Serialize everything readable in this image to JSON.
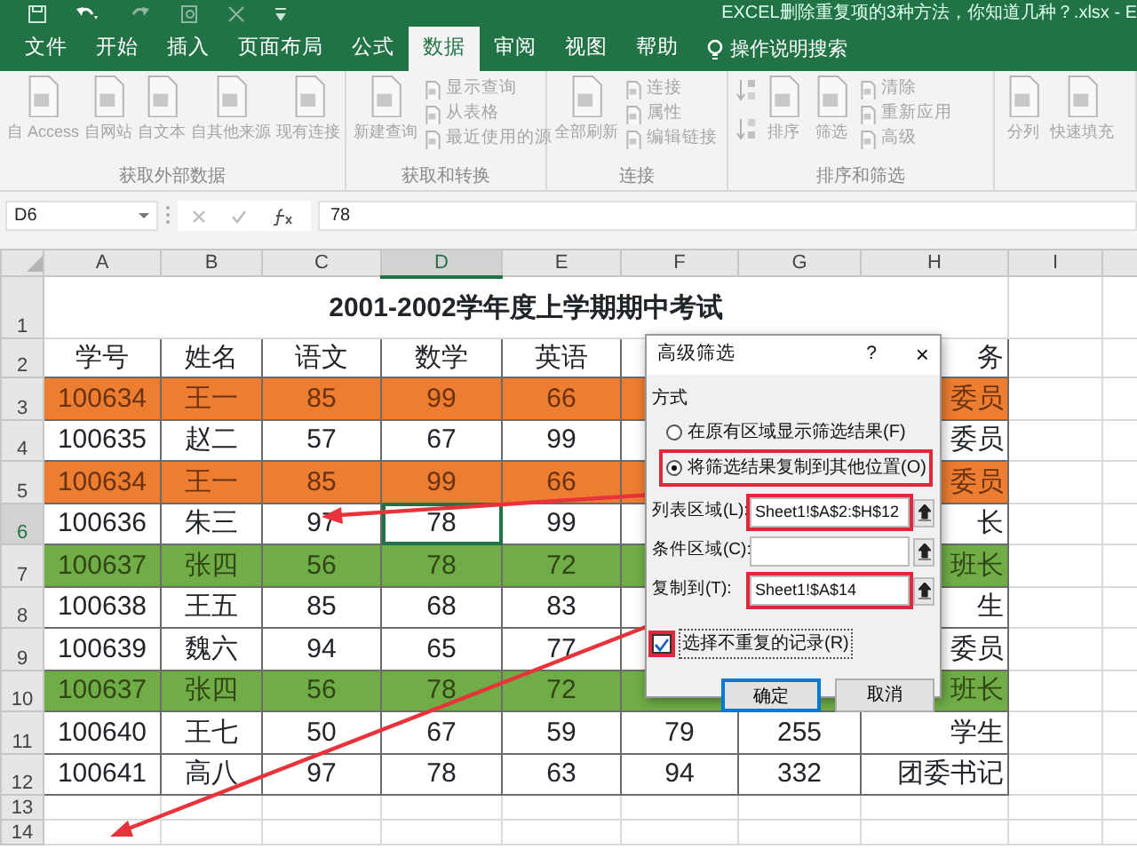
{
  "window": {
    "title": "EXCEL删除重复项的3种方法，你知道几种？.xlsx - E"
  },
  "tabs": [
    {
      "label": "文件",
      "selected": false
    },
    {
      "label": "开始",
      "selected": false
    },
    {
      "label": "插入",
      "selected": false
    },
    {
      "label": "页面布局",
      "selected": false
    },
    {
      "label": "公式",
      "selected": false
    },
    {
      "label": "数据",
      "selected": true
    },
    {
      "label": "审阅",
      "selected": false
    },
    {
      "label": "视图",
      "selected": false
    },
    {
      "label": "帮助",
      "selected": false
    }
  ],
  "tell_me": "操作说明搜索",
  "ribbon": [
    {
      "label": "获取外部数据",
      "buttons": [
        {
          "kind": "large",
          "label": "自 Access"
        },
        {
          "kind": "large",
          "label": "自网站"
        },
        {
          "kind": "large",
          "label": "自文本"
        },
        {
          "kind": "large",
          "label": "自其他来源"
        },
        {
          "kind": "large",
          "label": "现有连接"
        }
      ]
    },
    {
      "label": "获取和转换",
      "buttons": [
        {
          "kind": "large",
          "label": "新建查询"
        },
        {
          "kind": "small",
          "label": "显示查询"
        },
        {
          "kind": "small",
          "label": "从表格"
        },
        {
          "kind": "small",
          "label": "最近使用的源"
        }
      ]
    },
    {
      "label": "连接",
      "buttons": [
        {
          "kind": "large",
          "label": "全部刷新"
        },
        {
          "kind": "small",
          "label": "连接"
        },
        {
          "kind": "small",
          "label": "属性"
        },
        {
          "kind": "small",
          "label": "编辑链接"
        }
      ]
    },
    {
      "label": "排序和筛选",
      "buttons": [
        {
          "kind": "sort"
        },
        {
          "kind": "large",
          "label": "排序"
        },
        {
          "kind": "large",
          "label": "筛选"
        },
        {
          "kind": "small",
          "label": "清除"
        },
        {
          "kind": "small",
          "label": "重新应用"
        },
        {
          "kind": "small",
          "label": "高级"
        }
      ]
    },
    {
      "buttons": [
        {
          "kind": "large",
          "label": "分列"
        },
        {
          "kind": "large",
          "label": "快速填充"
        }
      ]
    }
  ],
  "formula_bar": {
    "name_box": "D6",
    "value": "78"
  },
  "sheet": {
    "columns": [
      {
        "label": "A",
        "selected": false
      },
      {
        "label": "B",
        "selected": false
      },
      {
        "label": "C",
        "selected": false
      },
      {
        "label": "D",
        "selected": true
      },
      {
        "label": "E",
        "selected": false
      },
      {
        "label": "F",
        "selected": false
      },
      {
        "label": "G",
        "selected": false
      },
      {
        "label": "H",
        "selected": false
      },
      {
        "label": "I",
        "selected": false
      }
    ],
    "rows": [
      {
        "number": "1",
        "selected": false,
        "title": "2001-2002学年度上学期期中考试"
      },
      {
        "number": "2",
        "selected": false,
        "cells": {
          "A": "学号",
          "B": "姓名",
          "C": "语文",
          "D": "数学",
          "E": "英语",
          "H": "务"
        }
      },
      {
        "number": "3",
        "selected": false,
        "color": "#ed7d31",
        "cells": {
          "A": "100634",
          "B": "王一",
          "C": "85",
          "D": "99",
          "E": "66",
          "H": "委员"
        }
      },
      {
        "number": "4",
        "selected": false,
        "cells": {
          "A": "100635",
          "B": "赵二",
          "C": "57",
          "D": "67",
          "E": "99",
          "H": "委员"
        }
      },
      {
        "number": "5",
        "selected": false,
        "color": "#ed7d31",
        "cells": {
          "A": "100634",
          "B": "王一",
          "C": "85",
          "D": "99",
          "E": "66",
          "H": "委员"
        }
      },
      {
        "number": "6",
        "selected": true,
        "cells": {
          "A": "100636",
          "B": "朱三",
          "C": "97",
          "D": "78",
          "E": "99",
          "H": "长"
        }
      },
      {
        "number": "7",
        "selected": false,
        "color": "#70ad47",
        "cells": {
          "A": "100637",
          "B": "张四",
          "C": "56",
          "D": "78",
          "E": "72",
          "H": "班长"
        }
      },
      {
        "number": "8",
        "selected": false,
        "cells": {
          "A": "100638",
          "B": "王五",
          "C": "85",
          "D": "68",
          "E": "83",
          "H": "生"
        }
      },
      {
        "number": "9",
        "selected": false,
        "cells": {
          "A": "100639",
          "B": "魏六",
          "C": "94",
          "D": "65",
          "E": "77",
          "H": "委员"
        }
      },
      {
        "number": "10",
        "selected": false,
        "color": "#70ad47",
        "cells": {
          "A": "100637",
          "B": "张四",
          "C": "56",
          "D": "78",
          "E": "72",
          "H": "班长"
        }
      },
      {
        "number": "11",
        "selected": false,
        "cells": {
          "A": "100640",
          "B": "王七",
          "C": "50",
          "D": "67",
          "E": "59",
          "F": "79",
          "G": "255",
          "H": "学生"
        }
      },
      {
        "number": "12",
        "selected": false,
        "cells": {
          "A": "100641",
          "B": "高八",
          "C": "97",
          "D": "78",
          "E": "63",
          "F": "94",
          "G": "332",
          "H": "团委书记"
        }
      },
      {
        "number": "13",
        "selected": false
      },
      {
        "number": "14",
        "selected": false
      }
    ]
  },
  "dialog": {
    "title": "高级筛选",
    "help": "?",
    "close": "×",
    "section": "方式",
    "options": [
      {
        "label": "在原有区域显示筛选结果(F)",
        "selected": false,
        "highlighted": false
      },
      {
        "label": "将筛选结果复制到其他位置(O)",
        "selected": true,
        "highlighted": true
      }
    ],
    "fields": [
      {
        "label": "列表区域(L):",
        "value": "Sheet1!$A$2:$H$12",
        "highlighted": true
      },
      {
        "label": "条件区域(C):",
        "highlighted": false
      },
      {
        "label": "复制到(T):",
        "value": "Sheet1!$A$14",
        "highlighted": true
      }
    ],
    "checkbox": {
      "label": "选择不重复的记录(R)",
      "checked": true,
      "highlighted": true
    },
    "buttons": [
      {
        "label": "确定",
        "default": true
      },
      {
        "label": "取消",
        "default": false
      }
    ]
  }
}
